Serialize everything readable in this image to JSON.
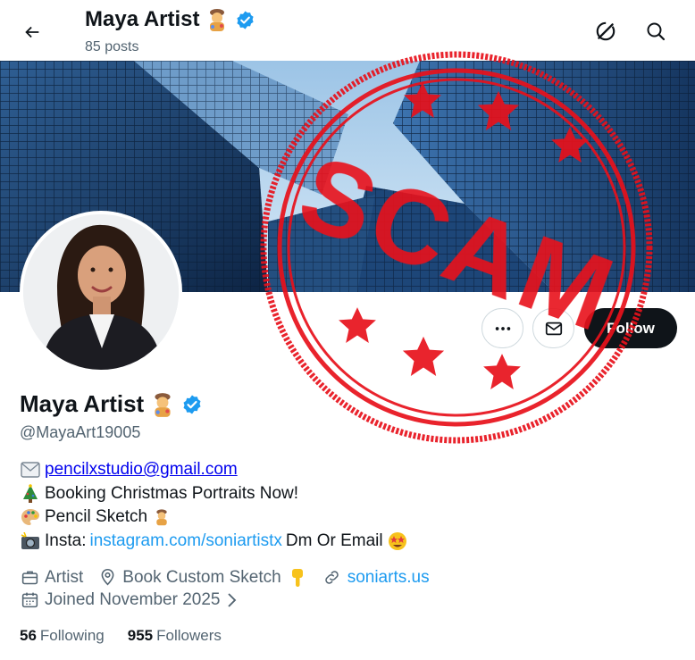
{
  "header": {
    "name": "Maya Artist",
    "posts_count": "85 posts"
  },
  "profile": {
    "display_name": "Maya Artist",
    "handle": "@MayaArt19005",
    "verified": true,
    "name_emoji": "artist-emoji",
    "badge_color": "#1d9bf0"
  },
  "actions": {
    "follow_label": "Follow"
  },
  "bio": {
    "email": "pencilxstudio@gmail.com",
    "line2": "Booking Christmas Portraits Now!",
    "line3": "Pencil Sketch",
    "line4_prefix": "Insta:",
    "line4_link": "instagram.com/soniartistx",
    "line4_suffix": "Dm Or Email"
  },
  "meta": {
    "category": "Artist",
    "location": "Book Custom Sketch",
    "website": "soniarts.us",
    "joined": "Joined November 2025"
  },
  "stats": {
    "following_count": "56",
    "following_label": "Following",
    "followers_count": "955",
    "followers_label": "Followers"
  },
  "overlay": {
    "stamp_text": "SCAM",
    "stamp_color": "#e8111b"
  }
}
